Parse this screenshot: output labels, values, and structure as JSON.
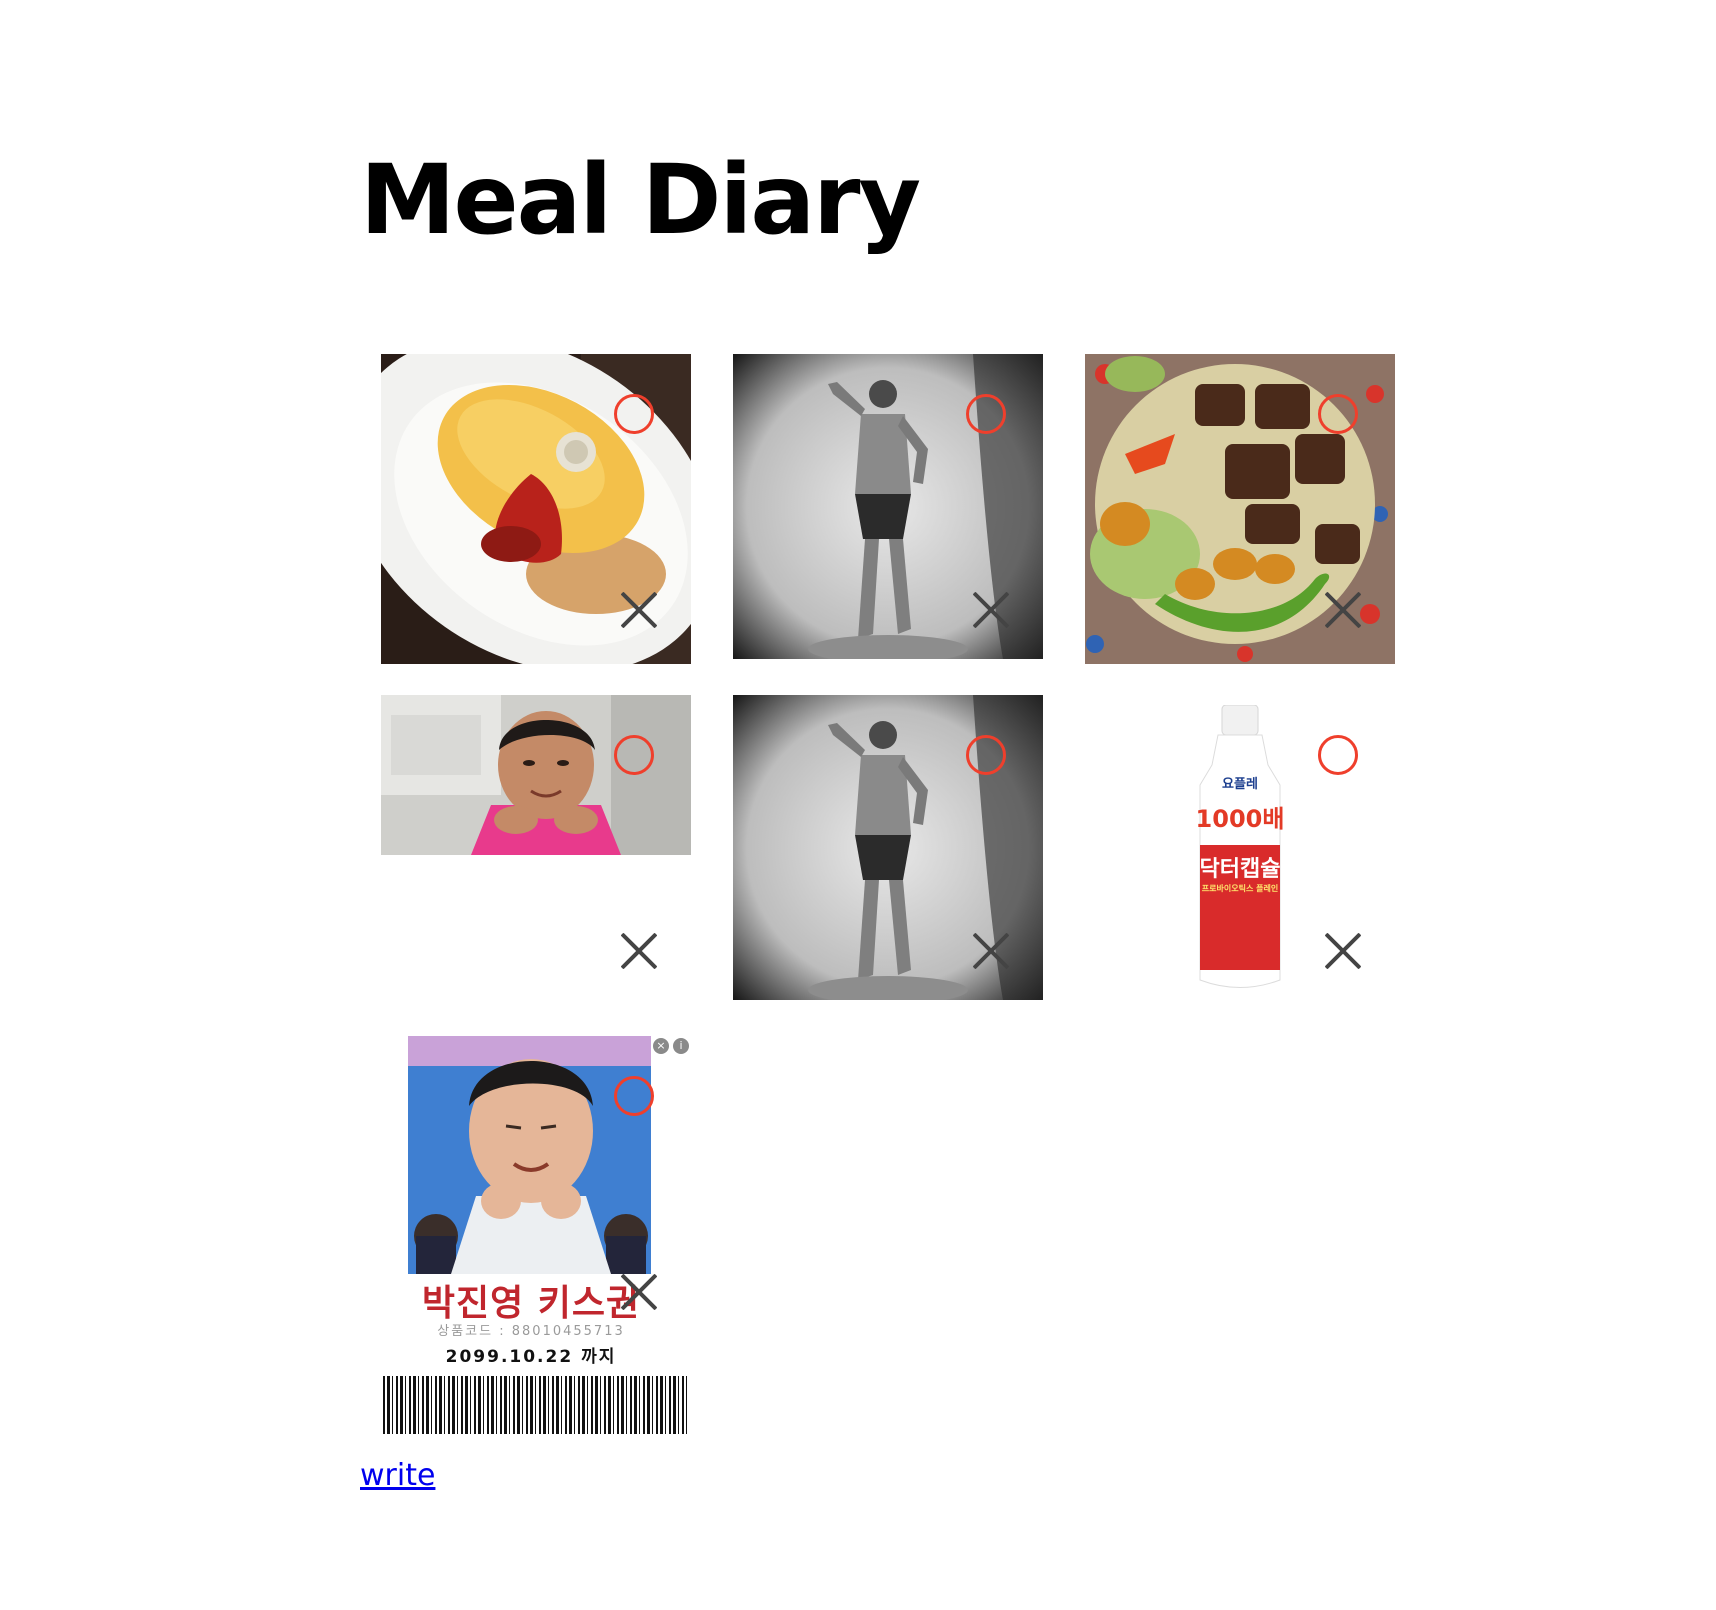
{
  "page": {
    "title": "Meal Diary",
    "write_link": "write"
  },
  "colors": {
    "o_button": "#ef3f2c",
    "x_button": "#444444",
    "link": "#0000ee"
  },
  "entries": [
    {
      "image": "omelette-rice-photo",
      "o_label": "O",
      "x_label": "X"
    },
    {
      "image": "black-and-white-man-shouting-photo",
      "o_label": "O",
      "x_label": "X"
    },
    {
      "image": "steak-rice-bowl-photo",
      "o_label": "O",
      "x_label": "X"
    },
    {
      "image": "man-in-pink-jacket-photo",
      "o_label": "O",
      "x_label": "X"
    },
    {
      "image": "black-and-white-man-shouting-photo",
      "o_label": "O",
      "x_label": "X"
    },
    {
      "image": "yogurt-drink-bottle-photo",
      "o_label": "O",
      "x_label": "X",
      "bottle": {
        "brand": "요플레",
        "headline": "1000배",
        "product": "닥터캡슐",
        "sub": "프로바이오틱스 플레인"
      }
    },
    {
      "image": "kiss-coupon-photo",
      "o_label": "O",
      "x_label": "X",
      "coupon": {
        "name": "박진영 키스권",
        "code": "상품코드 : 88010455713",
        "expiry": "2099.10.22 까지"
      }
    }
  ]
}
